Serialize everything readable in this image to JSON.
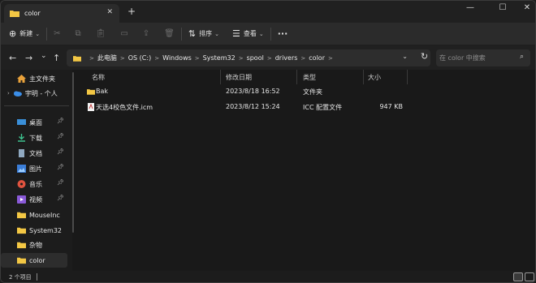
{
  "tab": {
    "title": "color",
    "close": "✕",
    "new": "+"
  },
  "window_controls": {
    "minimize": "—",
    "maximize": "☐",
    "close": "✕"
  },
  "toolbar": {
    "new_label": "新建",
    "sort_label": "排序",
    "view_label": "查看",
    "more": "···"
  },
  "nav": {
    "back": "←",
    "forward": "→",
    "dropdown": "⌄",
    "up": "↑"
  },
  "breadcrumb": [
    "此电脑",
    "OS (C:)",
    "Windows",
    "System32",
    "spool",
    "drivers",
    "color"
  ],
  "breadcrumb_sep": ">",
  "search": {
    "placeholder": "在 color 中搜索"
  },
  "sidebar": {
    "home": "主文件夹",
    "onedrive": "宇明 - 个人",
    "quick_access": [
      {
        "label": "桌面",
        "icon": "desktop-icon",
        "pinned": true
      },
      {
        "label": "下载",
        "icon": "download-icon",
        "pinned": true
      },
      {
        "label": "文档",
        "icon": "documents-icon",
        "pinned": true
      },
      {
        "label": "图片",
        "icon": "pictures-icon",
        "pinned": true
      },
      {
        "label": "音乐",
        "icon": "music-icon",
        "pinned": true
      },
      {
        "label": "视频",
        "icon": "videos-icon",
        "pinned": true
      },
      {
        "label": "MouseInc",
        "icon": "folder-icon",
        "pinned": false
      },
      {
        "label": "System32",
        "icon": "folder-icon",
        "pinned": false
      },
      {
        "label": "杂物",
        "icon": "folder-icon",
        "pinned": false
      },
      {
        "label": "color",
        "icon": "folder-icon",
        "pinned": false,
        "selected": true
      }
    ]
  },
  "columns": {
    "name": "名称",
    "modified": "修改日期",
    "type": "类型",
    "size": "大小"
  },
  "files": [
    {
      "name": "Bak",
      "modified": "2023/8/18 16:52",
      "type": "文件夹",
      "size": "",
      "icon": "folder-icon"
    },
    {
      "name": "天选4校色文件.icm",
      "modified": "2023/8/12 15:24",
      "type": "ICC 配置文件",
      "size": "947 KB",
      "icon": "icm-file-icon"
    }
  ],
  "status": {
    "count": "2 个项目"
  },
  "colors": {
    "folder": "#f3c744",
    "accent": "#4cc2ff",
    "background": "#191919"
  }
}
